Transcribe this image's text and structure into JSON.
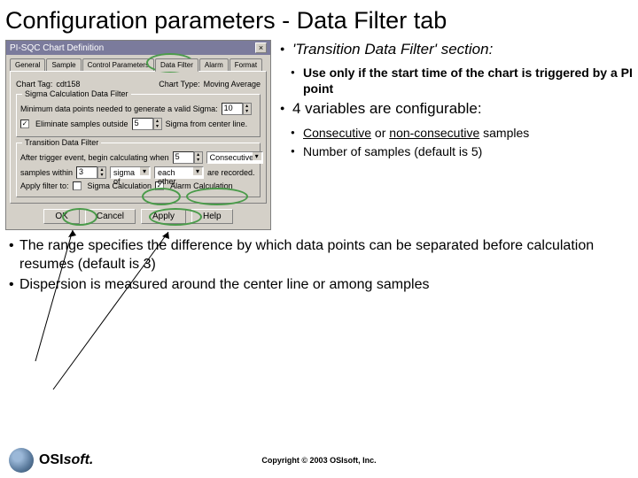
{
  "title": "Configuration parameters - Data Filter tab",
  "dialog": {
    "title": "PI-SQC Chart Definition",
    "tabs": [
      "General",
      "Sample",
      "Control Parameters",
      "Data Filter",
      "Alarm",
      "Format"
    ],
    "chart_tag_label": "Chart Tag:",
    "chart_tag_value": "cdt158",
    "chart_type_label": "Chart Type:",
    "chart_type_value": "Moving Average",
    "group1": {
      "legend": "Sigma Calculation Data Filter",
      "min_label": "Minimum data points needed to generate a valid Sigma:",
      "min_value": "10",
      "elim_label": "Eliminate samples outside",
      "elim_value": "5",
      "elim_suffix": "Sigma from center line."
    },
    "group2": {
      "legend": "Transition Data Filter",
      "trigger_label": "After trigger event, begin calculating when",
      "trigger_value": "5",
      "trigger_dd": "Consecutive",
      "within_label": "samples within",
      "within_value": "3",
      "within_dd1": "sigma of",
      "within_dd2": "each other",
      "within_suffix": "are recorded.",
      "apply_label": "Apply filter to:",
      "cb1": "Sigma Calculation",
      "cb2": "Alarm Calculation"
    },
    "buttons": {
      "ok": "OK",
      "cancel": "Cancel",
      "apply": "Apply",
      "help": "Help"
    }
  },
  "bullets": {
    "b1": "'Transition Data Filter' section:",
    "b1s1": "Use only if the start time of the chart is triggered by a PI  point",
    "b2": "4 variables are configurable:",
    "b2s1a": "Consecutive",
    "b2s1b": " or ",
    "b2s1c": "non-consecutive",
    "b2s1d": " samples",
    "b2s2": "Number of samples (default is 5)"
  },
  "lower": {
    "l1": "The range specifies the difference by which data points can be separated before calculation resumes (default is 3)",
    "l2": "Dispersion is measured around the center line or among samples"
  },
  "logo": {
    "osi": "OSI",
    "soft": "soft."
  },
  "copyright": "Copyright © 2003 OSIsoft, Inc."
}
